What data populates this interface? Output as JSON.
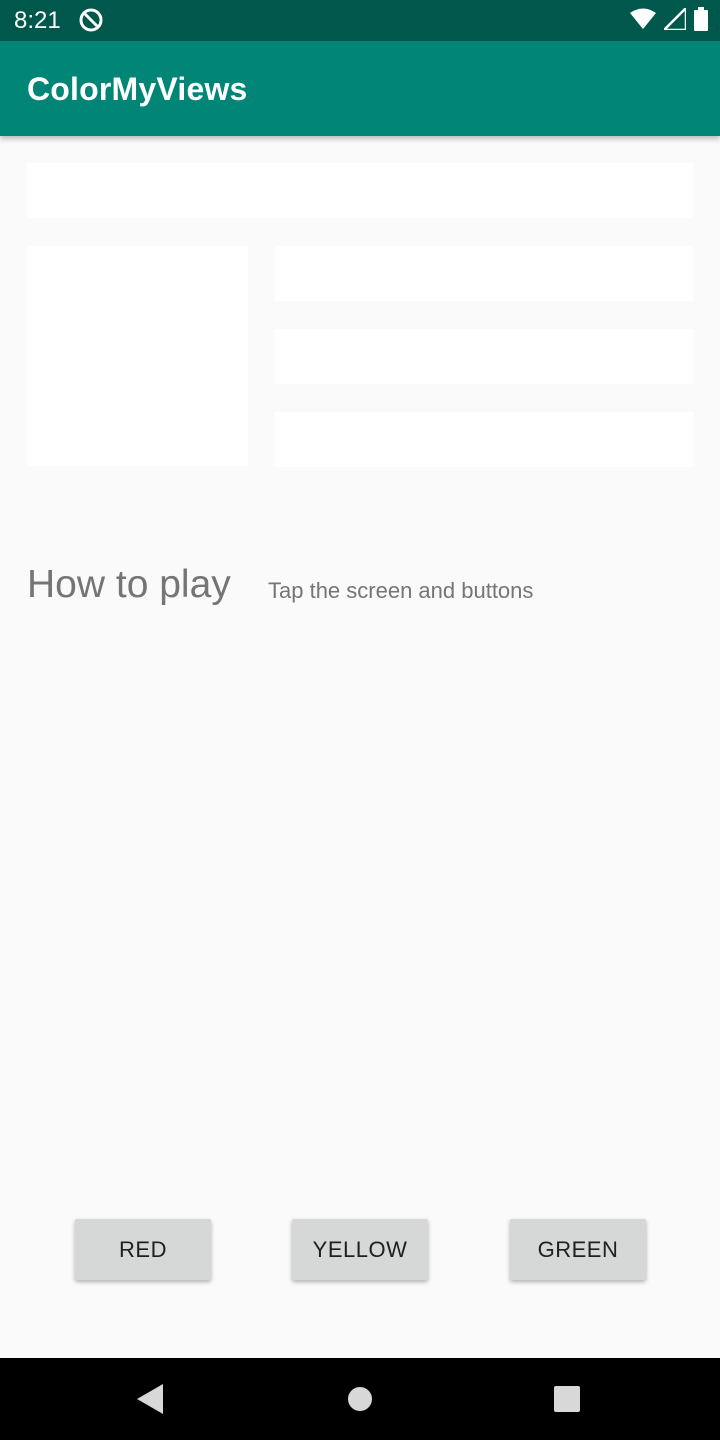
{
  "status_bar": {
    "time": "8:21",
    "icons": [
      "sync-icon",
      "wifi-icon",
      "signal-icon",
      "battery-icon"
    ]
  },
  "app_bar": {
    "title": "ColorMyViews"
  },
  "main": {
    "how_to_play_label": "How to play",
    "how_to_play_text": "Tap the screen and buttons"
  },
  "buttons": {
    "red_label": "RED",
    "yellow_label": "YELLOW",
    "green_label": "GREEN"
  },
  "nav_bar": {
    "icons": [
      "back-icon",
      "home-icon",
      "recents-icon"
    ]
  },
  "colors": {
    "status_bar": "#00574b",
    "app_bar": "#008577",
    "background": "#fafafa",
    "box": "#ffffff",
    "button": "#d6d7d7"
  }
}
